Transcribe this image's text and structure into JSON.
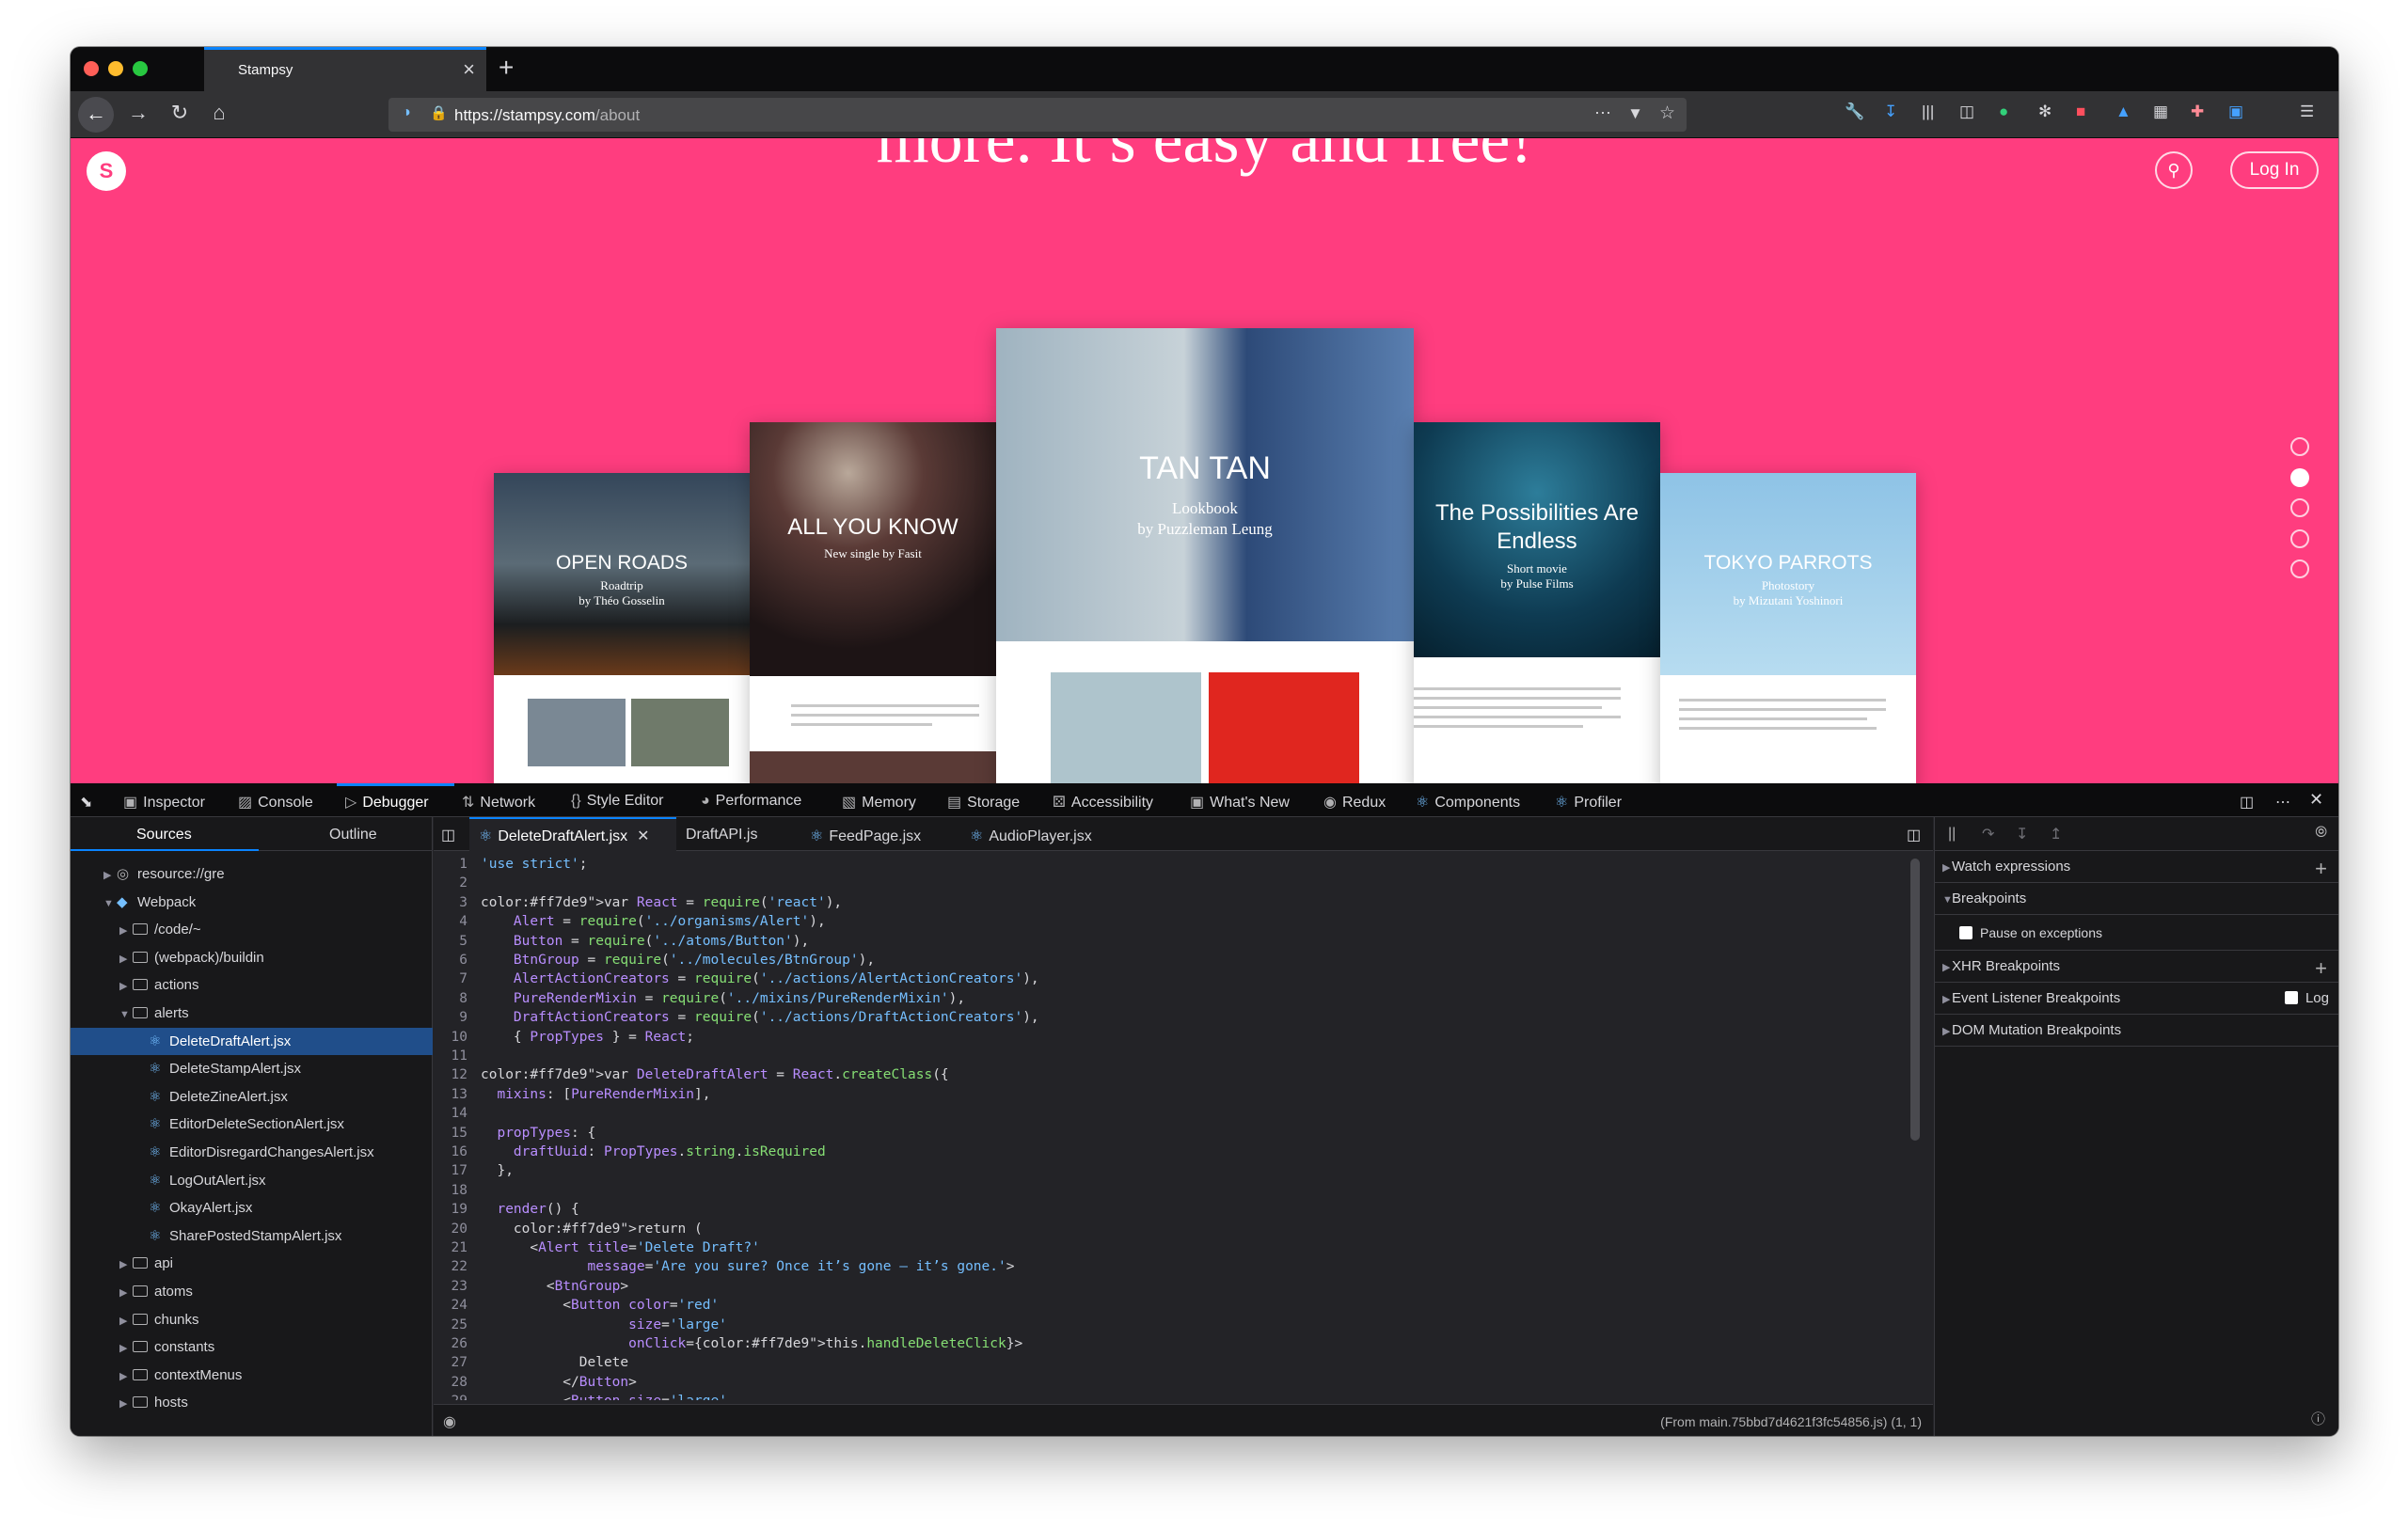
{
  "browser": {
    "tab_title": "Stampsy",
    "url_domain": "https://stampsy.com",
    "url_path": "/about",
    "new_tab": "+",
    "close": "×"
  },
  "page": {
    "hero_text": "more. It’s easy and free!",
    "logo_letter": "S",
    "login_label": "Log In",
    "cards": [
      {
        "title": "OPEN ROADS",
        "sub1": "Roadtrip",
        "sub2": "by Théo Gosselin"
      },
      {
        "title": "ALL YOU KNOW",
        "sub1": "New single by Fasit",
        "sub2": ""
      },
      {
        "title": "TAN TAN",
        "sub1": "Lookbook",
        "sub2": "by Puzzleman Leung"
      },
      {
        "title": "The Possibilities Are Endless",
        "sub1": "Short movie",
        "sub2": "by Pulse Films"
      },
      {
        "title": "TOKYO PARROTS",
        "sub1": "Photostory",
        "sub2": "by Mizutani Yoshinori"
      }
    ]
  },
  "devtools": {
    "tabs": [
      "Inspector",
      "Console",
      "Debugger",
      "Network",
      "Style Editor",
      "Performance",
      "Memory",
      "Storage",
      "Accessibility",
      "What's New",
      "Redux",
      "Components",
      "Profiler"
    ],
    "left_tabs": [
      "Sources",
      "Outline"
    ],
    "tree": [
      {
        "label": "resource://gre",
        "type": "globe",
        "depth": 1
      },
      {
        "label": "Webpack",
        "type": "webpack",
        "depth": 1
      },
      {
        "label": "/code/~",
        "type": "folder",
        "depth": 2
      },
      {
        "label": "(webpack)/buildin",
        "type": "folder",
        "depth": 2
      },
      {
        "label": "actions",
        "type": "folder",
        "depth": 2
      },
      {
        "label": "alerts",
        "type": "folder-open",
        "depth": 2
      },
      {
        "label": "DeleteDraftAlert.jsx",
        "type": "file",
        "depth": 3,
        "selected": true
      },
      {
        "label": "DeleteStampAlert.jsx",
        "type": "file",
        "depth": 3
      },
      {
        "label": "DeleteZineAlert.jsx",
        "type": "file",
        "depth": 3
      },
      {
        "label": "EditorDeleteSectionAlert.jsx",
        "type": "file",
        "depth": 3
      },
      {
        "label": "EditorDisregardChangesAlert.jsx",
        "type": "file",
        "depth": 3
      },
      {
        "label": "LogOutAlert.jsx",
        "type": "file",
        "depth": 3
      },
      {
        "label": "OkayAlert.jsx",
        "type": "file",
        "depth": 3
      },
      {
        "label": "SharePostedStampAlert.jsx",
        "type": "file",
        "depth": 3
      },
      {
        "label": "api",
        "type": "folder",
        "depth": 2
      },
      {
        "label": "atoms",
        "type": "folder",
        "depth": 2
      },
      {
        "label": "chunks",
        "type": "folder",
        "depth": 2
      },
      {
        "label": "constants",
        "type": "folder",
        "depth": 2
      },
      {
        "label": "contextMenus",
        "type": "folder",
        "depth": 2
      },
      {
        "label": "hosts",
        "type": "folder",
        "depth": 2
      }
    ],
    "editor_tabs": [
      "DeleteDraftAlert.jsx",
      "DraftAPI.js",
      "FeedPage.jsx",
      "AudioPlayer.jsx"
    ],
    "code": [
      "'use strict';",
      "",
      "var React = require('react'),",
      "    Alert = require('../organisms/Alert'),",
      "    Button = require('../atoms/Button'),",
      "    BtnGroup = require('../molecules/BtnGroup'),",
      "    AlertActionCreators = require('../actions/AlertActionCreators'),",
      "    PureRenderMixin = require('../mixins/PureRenderMixin'),",
      "    DraftActionCreators = require('../actions/DraftActionCreators'),",
      "    { PropTypes } = React;",
      "",
      "var DeleteDraftAlert = React.createClass({",
      "  mixins: [PureRenderMixin],",
      "",
      "  propTypes: {",
      "    draftUuid: PropTypes.string.isRequired",
      "  },",
      "",
      "  render() {",
      "    return (",
      "      <Alert title='Delete Draft?'",
      "             message='Are you sure? Once it’s gone — it’s gone.'>",
      "        <BtnGroup>",
      "          <Button color='red'",
      "                  size='large'",
      "                  onClick={this.handleDeleteClick}>",
      "            Delete",
      "          </Button>",
      "          <Button size='large'"
    ],
    "status": "(From main.75bbd7d4621f3fc54856.js)  (1, 1)",
    "right": {
      "watch": "Watch expressions",
      "breakpoints": "Breakpoints",
      "pause": "Pause on exceptions",
      "xhr": "XHR Breakpoints",
      "event": "Event Listener Breakpoints",
      "log": "Log",
      "dom": "DOM Mutation Breakpoints"
    }
  },
  "colors": {
    "accent": "#0a84ff",
    "page_bg": "#ff3d7f",
    "devtools_bg": "#232327"
  }
}
